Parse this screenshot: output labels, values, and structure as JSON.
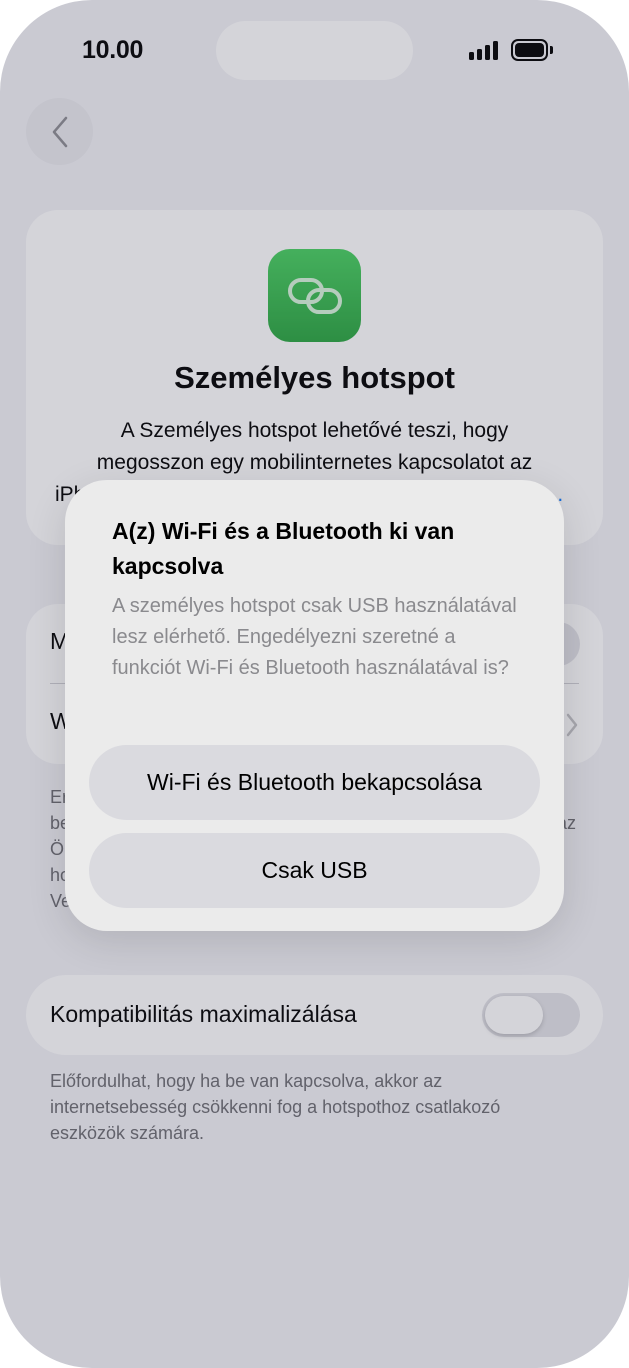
{
  "status_bar": {
    "time": "10.00",
    "signal_icon": "cellular-signal-icon",
    "battery_icon": "battery-full-icon"
  },
  "nav": {
    "back_icon": "chevron-left-icon"
  },
  "hero": {
    "icon": "link-icon",
    "icon_color": "#34c759",
    "title": "Személyes hotspot",
    "desc_line1": "A Személyes hotspot lehetővé teszi, hogy",
    "desc_line2": "megosszon egy mobilinternetes kapcsolatot az",
    "desc_line3_visible": "iPh",
    "desc_link_visible": "n..."
  },
  "settings": {
    "row1_label_visible": "M",
    "row2_label_visible": "W",
    "footnote_visible_left": [
      "Er",
      "be",
      "Ö",
      "ho",
      "Ve"
    ],
    "footnote_visible_right": "az"
  },
  "compat": {
    "label": "Kompatibilitás maximalizálása",
    "toggle_state": "off",
    "footnote": "Előfordulhat, hogy ha be van kapcsolva, akkor az internetsebesség csökkenni fog a hotspothoz csatlakozó eszközök számára."
  },
  "alert": {
    "title": "A(z) Wi-Fi és a Bluetooth ki van kapcsolva",
    "message": "A személyes hotspot csak USB használatával lesz elérhető. Engedélyezni szeretné a funkciót Wi-Fi és Bluetooth használatával is?",
    "primary_button": "Wi-Fi és Bluetooth bekapcsolása",
    "secondary_button": "Csak USB"
  },
  "colors": {
    "accent": "#0a7aff",
    "background": "#f2f2f7"
  }
}
